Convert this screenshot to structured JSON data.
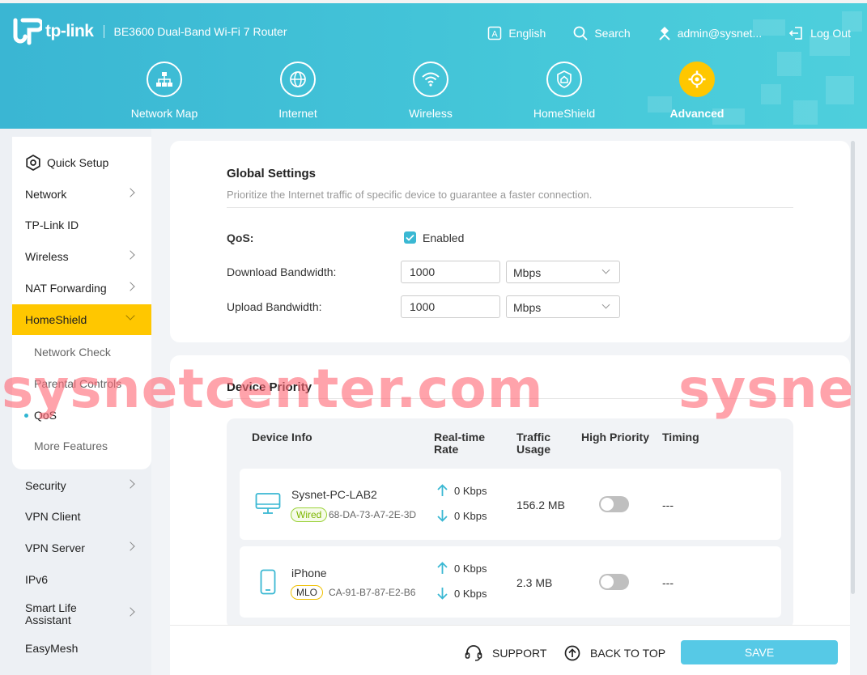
{
  "header": {
    "logo_text": "tp-link",
    "model": "BE3600 Dual-Band Wi-Fi 7 Router",
    "language": "English",
    "search": "Search",
    "user": "admin@sysnet...",
    "logout": "Log Out"
  },
  "mainnav": {
    "tabs": [
      {
        "label": "Network Map",
        "icon": "network-map-icon"
      },
      {
        "label": "Internet",
        "icon": "globe-icon"
      },
      {
        "label": "Wireless",
        "icon": "wifi-icon"
      },
      {
        "label": "HomeShield",
        "icon": "homeshield-icon"
      },
      {
        "label": "Advanced",
        "icon": "gear-icon",
        "active": true
      }
    ]
  },
  "sidebar": {
    "items": [
      {
        "label": "Quick Setup"
      },
      {
        "label": "Network"
      },
      {
        "label": "TP-Link ID"
      },
      {
        "label": "Wireless"
      },
      {
        "label": "NAT Forwarding"
      },
      {
        "label": "HomeShield"
      },
      {
        "label": "Network Check"
      },
      {
        "label": "Parental Controls"
      },
      {
        "label": "QoS"
      },
      {
        "label": "More Features"
      },
      {
        "label": "Security"
      },
      {
        "label": "VPN Client"
      },
      {
        "label": "VPN Server"
      },
      {
        "label": "IPv6"
      },
      {
        "label": "Smart Life Assistant"
      },
      {
        "label": "EasyMesh"
      }
    ]
  },
  "global": {
    "title": "Global Settings",
    "desc": "Prioritize the Internet traffic of specific device to guarantee a faster connection.",
    "qos_label": "QoS:",
    "qos_enabled": "Enabled",
    "download_label": "Download Bandwidth:",
    "download_value": "1000",
    "download_unit": "Mbps",
    "upload_label": "Upload Bandwidth:",
    "upload_value": "1000",
    "upload_unit": "Mbps"
  },
  "priority": {
    "title": "Device Priority",
    "columns": {
      "device_info": "Device Info",
      "rate_1": "Real-time",
      "rate_2": "Rate",
      "traffic_1": "Traffic",
      "traffic_2": "Usage",
      "high": "High Priority",
      "timing": "Timing"
    },
    "rows": [
      {
        "name": "Sysnet-PC-LAB2",
        "tag": "Wired",
        "mac": "68-DA-73-A7-2E-3D",
        "up": "0 Kbps",
        "down": "0 Kbps",
        "usage": "156.2 MB",
        "timing": "---"
      },
      {
        "name": "iPhone",
        "tag": "MLO",
        "mac": "CA-91-B7-87-E2-B6",
        "up": "0 Kbps",
        "down": "0 Kbps",
        "usage": "2.3 MB",
        "timing": "---"
      }
    ]
  },
  "footer": {
    "support": "SUPPORT",
    "back_to_top": "BACK TO TOP",
    "save": "SAVE"
  },
  "watermark": {
    "text1": "sysnetcenter.com",
    "text2": "sysne"
  },
  "colors": {
    "header": "#45c7d9",
    "accent": "#ffc700",
    "primary": "#3ab8d3",
    "save_button": "#56c9e6"
  }
}
